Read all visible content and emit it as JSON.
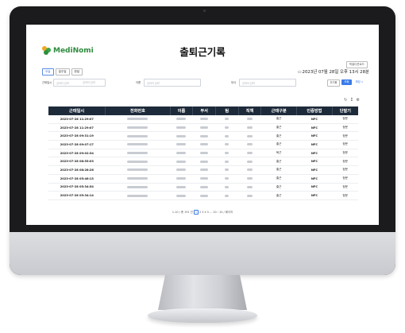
{
  "app": {
    "logo_text": "MediNomi",
    "page_title": "출퇴근기록",
    "excel_button": "엑셀다운로드",
    "datetime": "2023년 07월 28일 오후 13시 28분"
  },
  "tabs": [
    {
      "label": "오늘",
      "active": true
    },
    {
      "label": "일주일",
      "active": false
    },
    {
      "label": "한달",
      "active": false
    }
  ],
  "filters": {
    "date_label": "근태일시",
    "date_from_placeholder": "검색어 입력",
    "date_to_placeholder": "검색어 입력",
    "name_label": "이름",
    "name_placeholder": "검색어 입력",
    "dept_label": "부서",
    "dept_placeholder": "검색어 입력",
    "reset_label": "초기화",
    "search_label": "조회",
    "more_label": "확장 ∨"
  },
  "table": {
    "columns": [
      "근태일시",
      "전화번호",
      "이름",
      "부서",
      "팀",
      "직책",
      "근태구분",
      "인증방법",
      "단말기"
    ],
    "rows": [
      {
        "datetime": "2023-07-28 11:29:07",
        "type": "출근",
        "auth": "NFC",
        "device": "정문"
      },
      {
        "datetime": "2023-07-28 11:29:07",
        "type": "출근",
        "auth": "NFC",
        "device": "정문"
      },
      {
        "datetime": "2023-07-28 09:31:19",
        "type": "출근",
        "auth": "NFC",
        "device": "정문"
      },
      {
        "datetime": "2023-07-28 09:07:17",
        "type": "출근",
        "auth": "NFC",
        "device": "정문"
      },
      {
        "datetime": "2023-07-28 09:02:34",
        "type": "퇴근",
        "auth": "NFC",
        "device": "정문"
      },
      {
        "datetime": "2023-07-28 08:55:03",
        "type": "출근",
        "auth": "NFC",
        "device": "정문"
      },
      {
        "datetime": "2023-07-28 08:28:26",
        "type": "출근",
        "auth": "NFC",
        "device": "정문"
      },
      {
        "datetime": "2023-07-28 05:46:13",
        "type": "출근",
        "auth": "NFC",
        "device": "정문"
      },
      {
        "datetime": "2023-07-28 05:34:54",
        "type": "출근",
        "auth": "NFC",
        "device": "정문"
      },
      {
        "datetime": "2023-07-28 05:34:14",
        "type": "출근",
        "auth": "NFC",
        "device": "정문"
      }
    ]
  },
  "pager": {
    "summary": "1-10 / 총 191 건",
    "current": "1",
    "pages": "2  3  4  5  ...  20  ›  10 / 페이지"
  },
  "icons": [
    "refresh-icon",
    "sum-icon",
    "settings-icon",
    "calendar-icon",
    "clock-icon"
  ]
}
